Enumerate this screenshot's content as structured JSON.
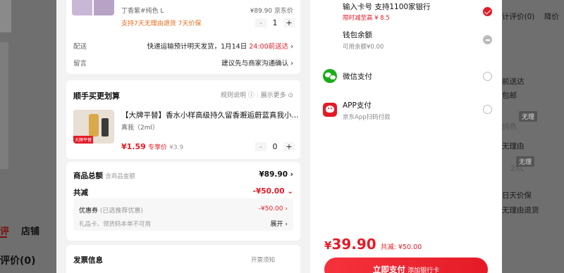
{
  "background": {
    "left_tabs": [
      "评",
      "店铺"
    ],
    "left_rating": "评价(0)",
    "right_lines": [
      "计评价(0)",
      "降价",
      "前送达",
      "包邮",
      "无理由",
      "纯色",
      "无理由",
      "2XL",
      "日天价保",
      "无理由退货"
    ],
    "badges": [
      "无理",
      "无理"
    ]
  },
  "product": {
    "spec": "丁香紫#纯色  L",
    "price": "¥89.90",
    "price_source": "京东价",
    "service": "支持7天无理由退货  7天价保",
    "quantity": "1",
    "minus": "-",
    "plus": "+"
  },
  "delivery": {
    "label": "配送",
    "value": "快递运输预计明天发货，1月14日",
    "value_highlight": "24:00前送达",
    "chevron": "›"
  },
  "note": {
    "label": "留言",
    "value": "建议先与商家沟通确认",
    "chevron": "›"
  },
  "addon": {
    "title": "顺手买更划算",
    "rules": "规则说明",
    "rules_icon": "ⓘ",
    "show_more": "展示更多",
    "show_more_icon": "⊙",
    "product_title": "【大牌平替】香水小样高级持久留香邂逅蔚蓝真我小...",
    "variant": "真我（2ml）",
    "price": "¥1.59",
    "price_tag": "专享价",
    "orig_price": "¥3.9",
    "quantity": "0",
    "minus": "-",
    "plus": "+",
    "image_tag": "大牌平替"
  },
  "summary": {
    "total_label": "商品总额",
    "total_note": "含商品金额",
    "total_value": "¥89.90",
    "discount_label": "共减",
    "discount_value": "-¥50.00",
    "coupon_label": "优惠券",
    "coupon_note": "(已选推荐优惠)",
    "coupon_value": "-¥50.00",
    "gift_label": "礼品卡、领货码本单不可用",
    "expand": "展开",
    "chevron": "›",
    "caret": "⌄"
  },
  "invoice": {
    "title": "发票信息",
    "note": "开票须知"
  },
  "payment": {
    "card_title": "输入卡号 支持1100家银行",
    "card_promo": "限时减至高 ¥ 8.5",
    "wallet_title": "钱包余额",
    "wallet_sub": "可用余额¥0.00",
    "wechat_title": "微信支付",
    "app_title": "APP支付",
    "app_sub": "京东App扫码付款"
  },
  "footer": {
    "currency": "¥",
    "total": "39.90",
    "saved": "共减: ¥50.00",
    "pay_button": "立即支付",
    "pay_sub": "添加银行卡"
  },
  "colors": {
    "accent": "#e41b26",
    "orange": "#e86a1a",
    "wechat": "#1aad19"
  }
}
